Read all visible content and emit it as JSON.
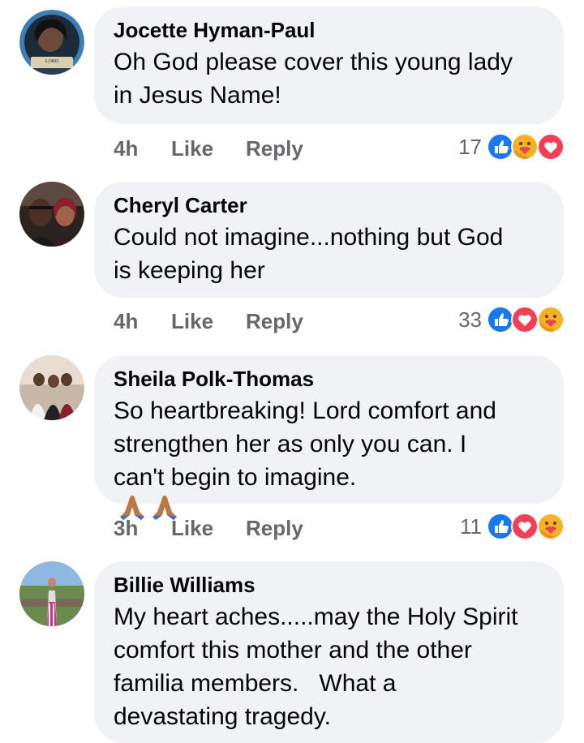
{
  "comments": [
    {
      "author": "Jocette Hyman-Paul",
      "text_lines": [
        "Oh God please cover this young lady",
        "in Jesus Name!"
      ],
      "time": "4h",
      "like_label": "Like",
      "reply_label": "Reply",
      "reaction_count": "17",
      "reactions": [
        "like",
        "care",
        "love"
      ],
      "avatar_badge": "LORD"
    },
    {
      "author": "Cheryl Carter",
      "text_lines": [
        "Could not imagine...nothing but God",
        "is keeping her"
      ],
      "time": "4h",
      "like_label": "Like",
      "reply_label": "Reply",
      "reaction_count": "33",
      "reactions": [
        "like",
        "love",
        "care"
      ]
    },
    {
      "author": "Sheila Polk-Thomas",
      "text_lines": [
        "So heartbreaking! Lord comfort and",
        "strengthen her as only you can. I",
        "can't begin to imagine."
      ],
      "trailing_emoji": "folded-hands",
      "time": "3h",
      "like_label": "Like",
      "reply_label": "Reply",
      "reaction_count": "11",
      "reactions": [
        "like",
        "love",
        "care"
      ]
    },
    {
      "author": "Billie Williams",
      "text_lines": [
        "My heart aches.....may the Holy Spirit",
        "comfort this mother and the other",
        "familia members.   What a",
        "devastating tragedy."
      ]
    }
  ],
  "colors": {
    "bubble": "#f0f2f5",
    "meta_text": "#65676b",
    "like_blue": "#1877f2",
    "love_red": "#f33e58",
    "care_yellow": "#f7b125"
  }
}
